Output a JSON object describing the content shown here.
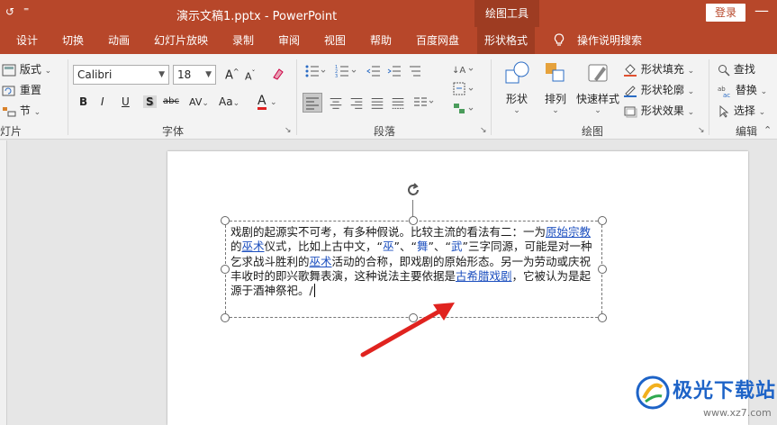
{
  "titlebar": {
    "quick_access_1": "↺",
    "quick_access_2": "⁼",
    "document_title": "演示文稿1.pptx  -  PowerPoint",
    "contextual_group": "绘图工具",
    "login_label": "登录",
    "minimize_label": "—"
  },
  "tabs": [
    {
      "label": "设计"
    },
    {
      "label": "切换"
    },
    {
      "label": "动画"
    },
    {
      "label": "幻灯片放映"
    },
    {
      "label": "录制"
    },
    {
      "label": "审阅"
    },
    {
      "label": "视图"
    },
    {
      "label": "帮助"
    },
    {
      "label": "百度网盘"
    },
    {
      "label": "形状格式"
    },
    {
      "label": "操作说明搜索"
    }
  ],
  "ribbon": {
    "slides_group": {
      "label": "灯片",
      "layout": "版式",
      "reset": "重置",
      "section": "节"
    },
    "font_group": {
      "label": "字体",
      "font_name": "Calibri",
      "font_size": "18",
      "grow": "A",
      "shrink": "A",
      "bold": "B",
      "italic": "I",
      "underline": "U",
      "shadow": "S",
      "strike": "abc",
      "spacing": "AV",
      "case": "Aa",
      "color": "A",
      "font_color_hex": "#e02020"
    },
    "paragraph_group": {
      "label": "段落"
    },
    "drawing_group": {
      "label": "绘图",
      "shapes": "形状",
      "arrange": "排列",
      "quick_styles": "快速样式",
      "fill": "形状填充",
      "outline": "形状轮廓",
      "effects": "形状效果"
    },
    "editing_group": {
      "label": "编辑",
      "find": "查找",
      "replace": "替换",
      "select": "选择"
    }
  },
  "slide": {
    "text_before": "戏剧的起源实不可考，有多种假说。比较主流的看法有二：一为",
    "link1": "原始宗教",
    "text_a": "的",
    "link2": "巫术",
    "text_b": "仪式，比如上古中文，“",
    "q1": "巫",
    "text_c": "”、“",
    "q2": "舞",
    "text_d": "”、“",
    "q3": "武",
    "text_e": "”三字同源，可能是对一种乞求战斗胜利的",
    "link3": "巫术",
    "text_f": "活动的合称，即戏剧的原始形态。另一为劳动或庆祝丰收时的即兴歌舞表演，这种说法主要依据是",
    "link4": "古希腊戏剧",
    "text_g": "，它被认为是起源于酒神祭祀。/"
  },
  "watermark": {
    "title": "极光下载站",
    "url": "www.xz7.com"
  },
  "colors": {
    "accent": "#b7472a",
    "accent_dark": "#9e3c22",
    "link": "#1c4fbf",
    "arrow": "#e0231f"
  }
}
